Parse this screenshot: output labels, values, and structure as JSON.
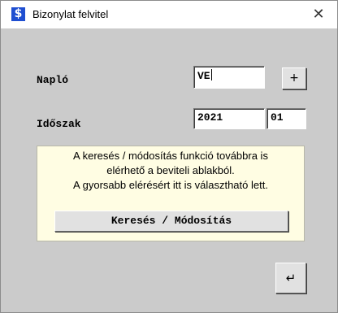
{
  "window": {
    "title": "Bizonylat felvitel",
    "app_icon": "$",
    "close_label": "✕"
  },
  "form": {
    "naplo_label": "Napló",
    "naplo_value": "VE",
    "add_button_label": "+",
    "idoszak_label": "Időszak",
    "year_value": "2021",
    "month_value": "01"
  },
  "info": {
    "lines": [
      "A keresés / módosítás funkció továbbra is",
      "elérhető a beviteli ablakból.",
      "A gyorsabb elérésért itt is választható lett."
    ],
    "search_button_label": "Keresés / Módosítás"
  },
  "footer": {
    "enter_button_label": "↵"
  },
  "icons": {
    "app": "dollar-icon",
    "close": "close-icon",
    "enter": "enter-icon"
  },
  "colors": {
    "app_icon_bg": "#1f4fd1",
    "client_bg": "#cbcbcb",
    "info_bg": "#fffde3"
  }
}
